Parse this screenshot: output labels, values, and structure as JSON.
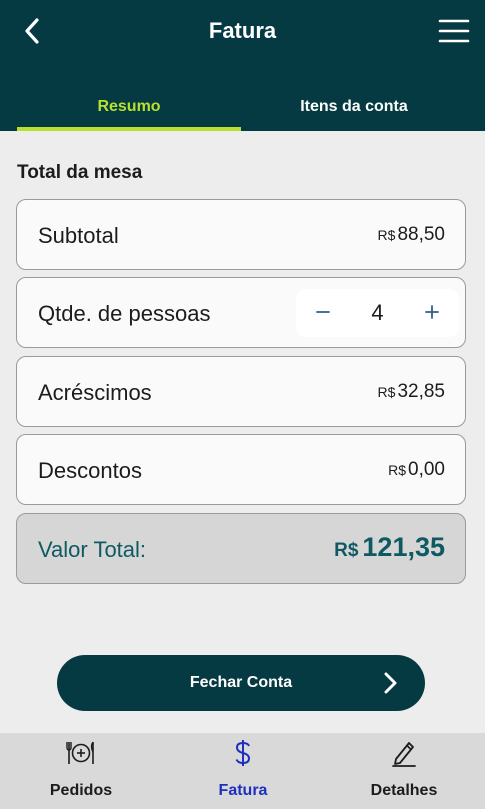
{
  "header": {
    "title": "Fatura",
    "back_icon": "chevron-left-icon",
    "menu_icon": "hamburger-menu-icon"
  },
  "tabs": [
    {
      "label": "Resumo",
      "active": true
    },
    {
      "label": "Itens da conta",
      "active": false
    }
  ],
  "section_title": "Total da mesa",
  "subtotal": {
    "label": "Subtotal",
    "currency": "R$",
    "amount": "88,50"
  },
  "people": {
    "label": "Qtde. de pessoas",
    "minus": "−",
    "count": "4",
    "plus": "+"
  },
  "surcharges": {
    "label": "Acréscimos",
    "currency": "R$",
    "amount": "32,85"
  },
  "discounts": {
    "label": "Descontos",
    "currency": "R$",
    "amount": "0,00"
  },
  "total": {
    "label": "Valor Total:",
    "currency": "R$",
    "amount": "121,35"
  },
  "close_button": {
    "label": "Fechar Conta",
    "icon": "chevron-right-icon"
  },
  "bottom_nav": [
    {
      "label": "Pedidos",
      "icon": "plate-cutlery-icon",
      "active": false
    },
    {
      "label": "Fatura",
      "icon": "dollar-icon",
      "active": true
    },
    {
      "label": "Detalhes",
      "icon": "pencil-icon",
      "active": false
    }
  ],
  "colors": {
    "header_bg": "#053a42",
    "accent_tab": "#b7e02f",
    "total_text": "#0f5962",
    "active_nav": "#1f2fbf",
    "stepper_symbol": "#2f5f8f"
  }
}
